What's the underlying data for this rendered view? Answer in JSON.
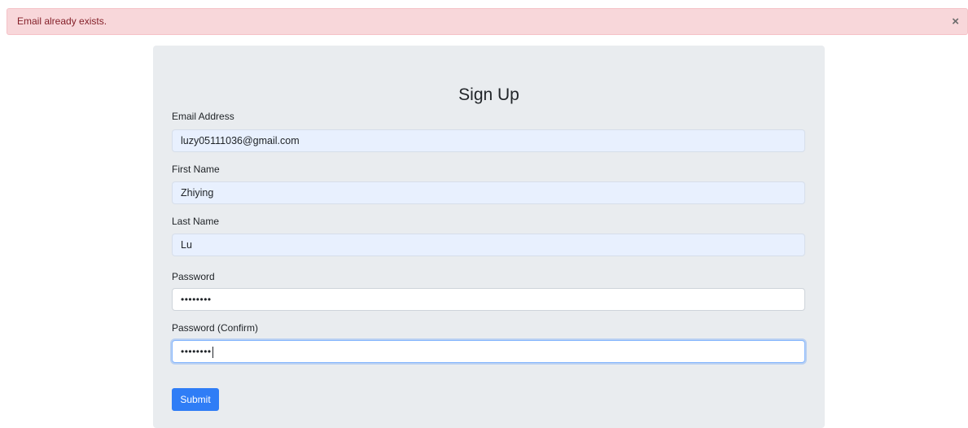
{
  "alert": {
    "message": "Email already exists.",
    "close_symbol": "×",
    "color": "#f8d7da"
  },
  "form": {
    "title": "Sign Up",
    "fields": [
      {
        "label": "Email Address",
        "value": "luzy05111036@gmail.com"
      },
      {
        "label": "First Name",
        "value": "Zhiying"
      },
      {
        "label": "Last Name",
        "value": "Lu"
      },
      {
        "label": "Password",
        "value": "••••••••"
      },
      {
        "label": "Password (Confirm)",
        "value": "••••••••"
      }
    ],
    "submit_label": "Submit",
    "accent_color": "#2f7df6"
  }
}
